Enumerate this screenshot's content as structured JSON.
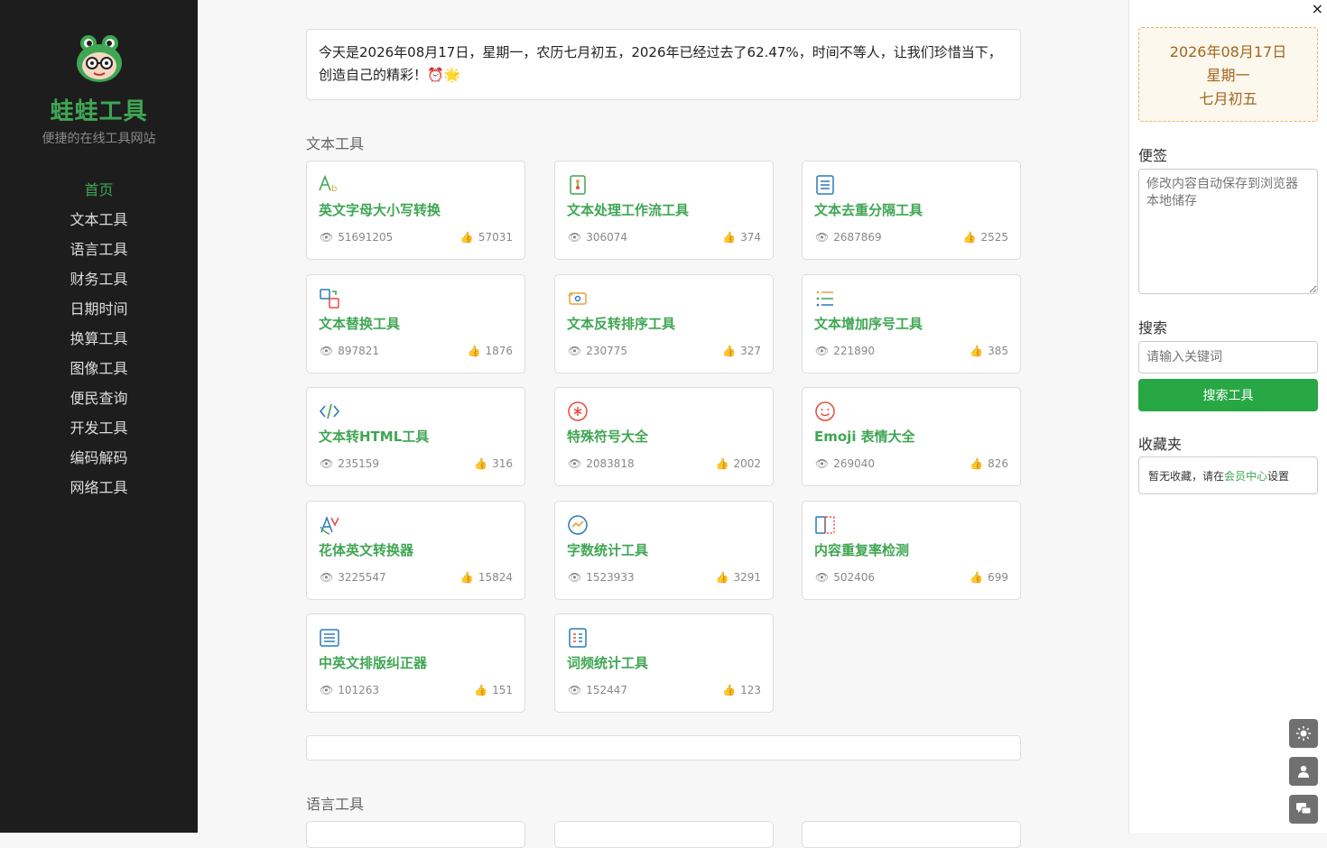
{
  "brand": {
    "name": "蛙蛙工具",
    "tagline": "便捷的在线工具网站"
  },
  "nav": {
    "items": [
      {
        "label": "首页",
        "active": true
      },
      {
        "label": "文本工具"
      },
      {
        "label": "语言工具"
      },
      {
        "label": "财务工具"
      },
      {
        "label": "日期时间"
      },
      {
        "label": "换算工具"
      },
      {
        "label": "图像工具"
      },
      {
        "label": "便民查询"
      },
      {
        "label": "开发工具"
      },
      {
        "label": "编码解码"
      },
      {
        "label": "网络工具"
      }
    ]
  },
  "banner": {
    "text": "今天是2026年08月17日，星期一，农历七月初五，2026年已经过去了62.47%，时间不等人，让我们珍惜当下，创造自己的精彩！⏰🌟"
  },
  "sections": {
    "text_tools": {
      "title": "文本工具",
      "cards": [
        {
          "title": "英文字母大小写转换",
          "views": "51691205",
          "likes": "57031",
          "icon": "letter-case-icon"
        },
        {
          "title": "文本处理工作流工具",
          "views": "306074",
          "likes": "374",
          "icon": "workflow-icon"
        },
        {
          "title": "文本去重分隔工具",
          "views": "2687869",
          "likes": "2525",
          "icon": "dedupe-list-icon"
        },
        {
          "title": "文本替换工具",
          "views": "897821",
          "likes": "1876",
          "icon": "replace-icon"
        },
        {
          "title": "文本反转排序工具",
          "views": "230775",
          "likes": "327",
          "icon": "reverse-icon"
        },
        {
          "title": "文本增加序号工具",
          "views": "221890",
          "likes": "385",
          "icon": "numbered-list-icon"
        },
        {
          "title": "文本转HTML工具",
          "views": "235159",
          "likes": "316",
          "icon": "code-icon"
        },
        {
          "title": "特殊符号大全",
          "views": "2083818",
          "likes": "2002",
          "icon": "asterisk-icon"
        },
        {
          "title": "Emoji 表情大全",
          "views": "269040",
          "likes": "826",
          "icon": "smiley-icon"
        },
        {
          "title": "花体英文转换器",
          "views": "3225547",
          "likes": "15824",
          "icon": "fancy-letter-icon"
        },
        {
          "title": "字数统计工具",
          "views": "1523933",
          "likes": "3291",
          "icon": "chart-circle-icon"
        },
        {
          "title": "内容重复率检测",
          "views": "502406",
          "likes": "699",
          "icon": "compare-icon"
        },
        {
          "title": "中英文排版纠正器",
          "views": "101263",
          "likes": "151",
          "icon": "document-icon"
        },
        {
          "title": "词频统计工具",
          "views": "152447",
          "likes": "123",
          "icon": "frequency-icon"
        }
      ]
    },
    "language_tools": {
      "title": "语言工具"
    }
  },
  "right_panel": {
    "date_line1": "2026年08月17日",
    "date_line2": "星期一",
    "date_line3": "七月初五",
    "note_label": "便签",
    "note_placeholder": "修改内容自动保存到浏览器本地储存",
    "search_label": "搜索",
    "search_placeholder": "请输入关键词",
    "search_button": "搜索工具",
    "fav_label": "收藏夹",
    "fav_text_before": "暂无收藏，请在",
    "fav_link": "会员中心",
    "fav_text_after": "设置",
    "close": "×"
  },
  "colors": {
    "accent": "#3fa653",
    "sidebar_bg": "#1d1d1d",
    "button_green": "#28a745",
    "date_text": "#a2651b"
  }
}
